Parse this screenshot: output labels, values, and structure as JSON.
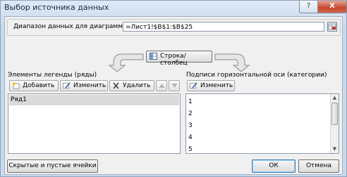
{
  "window": {
    "title": "Выбор источника данных",
    "help": "?",
    "close": "X"
  },
  "range": {
    "label": "Диапазон данных для диаграммы:",
    "value": "=Лист1!$B$1:$B$25"
  },
  "switch_button": "Строка/столбец",
  "legend": {
    "label": "Элементы легенды (ряды)",
    "add": "Добавить",
    "edit": "Изменить",
    "delete": "Удалить",
    "items": [
      "Ряд1"
    ]
  },
  "axis": {
    "label": "Подписи горизонтальной оси (категории)",
    "edit": "Изменить",
    "items": [
      "1",
      "2",
      "3",
      "4",
      "5"
    ]
  },
  "buttons": {
    "hidden_cells": "Скрытые и пустые ячейки",
    "ok": "ОК",
    "cancel": "Отмена"
  }
}
